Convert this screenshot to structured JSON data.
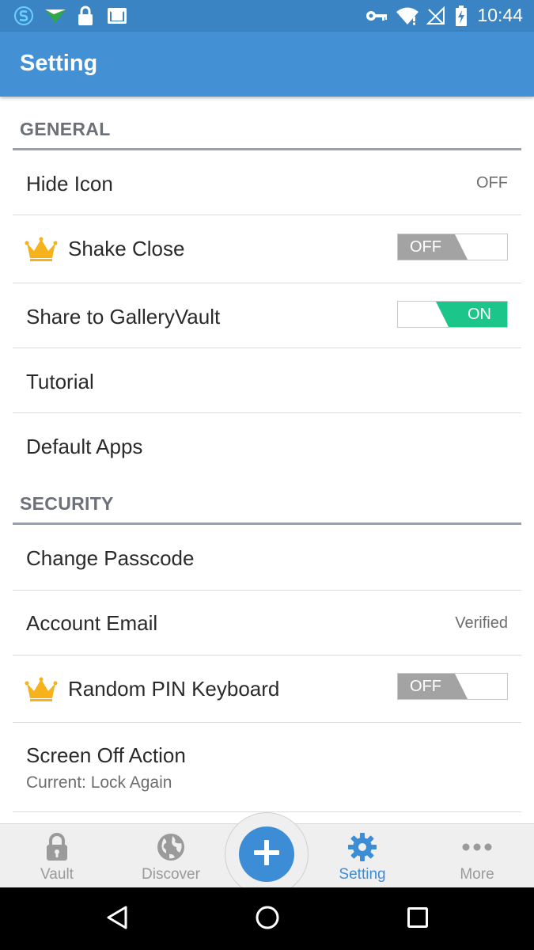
{
  "status_bar": {
    "time": "10:44",
    "icons": [
      "s-app-icon",
      "send-icon",
      "lock-icon",
      "mail-icon",
      "key-icon",
      "wifi-icon",
      "no-signal-icon",
      "battery-charging-icon"
    ]
  },
  "app_bar": {
    "title": "Setting"
  },
  "sections": {
    "general": {
      "header": "GENERAL",
      "hide_icon": {
        "label": "Hide Icon",
        "value": "OFF"
      },
      "shake_close": {
        "label": "Shake Close",
        "toggle": "OFF",
        "premium_icon": "crown-icon"
      },
      "share": {
        "label": "Share to GalleryVault",
        "toggle": "ON"
      },
      "tutorial": {
        "label": "Tutorial"
      },
      "default_apps": {
        "label": "Default Apps"
      }
    },
    "security": {
      "header": "SECURITY",
      "change_passcode": {
        "label": "Change Passcode"
      },
      "account_email": {
        "label": "Account Email",
        "value": "Verified"
      },
      "random_pin": {
        "label": "Random PIN Keyboard",
        "toggle": "OFF",
        "premium_icon": "crown-icon"
      },
      "screen_off": {
        "label": "Screen Off Action",
        "sub": "Current: Lock Again"
      }
    }
  },
  "bottom_nav": {
    "items": [
      {
        "label": "Vault",
        "icon": "lock-icon"
      },
      {
        "label": "Discover",
        "icon": "globe-icon"
      },
      {
        "label": "Setting",
        "icon": "gear-icon",
        "active": true
      },
      {
        "label": "More",
        "icon": "more-dots-icon"
      }
    ],
    "fab_icon": "plus-icon"
  },
  "colors": {
    "status_bar": "#3a84c4",
    "app_bar": "#4390d4",
    "accent": "#3d8dd6",
    "toggle_on": "#1cc58a",
    "toggle_off": "#a3a3a3",
    "crown": "#f5b21b"
  }
}
